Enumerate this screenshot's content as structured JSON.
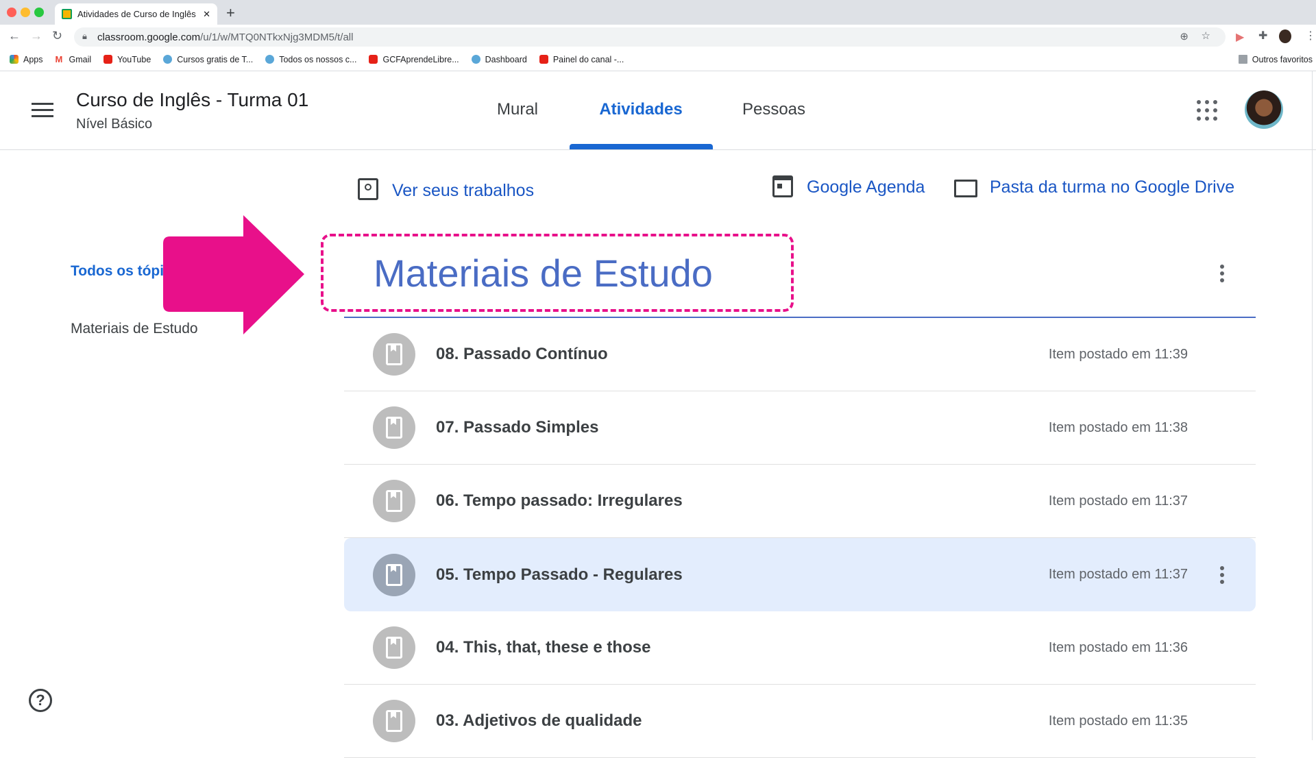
{
  "browser": {
    "tab_title": "Atividades de Curso de Inglês",
    "url_host": "classroom.google.com",
    "url_path": "/u/1/w/MTQ0NTkxNjg3MDM5/t/all",
    "bookmarks": [
      {
        "label": "Apps",
        "icon": "apps-grid-icon"
      },
      {
        "label": "Gmail",
        "icon": "gmail-icon"
      },
      {
        "label": "YouTube",
        "icon": "youtube-icon"
      },
      {
        "label": "Cursos gratis de T...",
        "icon": "globe-icon"
      },
      {
        "label": "Todos os nossos c...",
        "icon": "globe-icon"
      },
      {
        "label": "GCFAprendeLibre...",
        "icon": "youtube-icon"
      },
      {
        "label": "Dashboard",
        "icon": "globe-icon"
      },
      {
        "label": "Painel do canal -...",
        "icon": "youtube-icon"
      }
    ],
    "other_bookmarks": "Outros favoritos"
  },
  "header": {
    "class_title": "Curso de Inglês - Turma 01",
    "class_subtitle": "Nível Básico",
    "tabs": [
      {
        "label": "Mural"
      },
      {
        "label": "Atividades",
        "active": true
      },
      {
        "label": "Pessoas"
      }
    ]
  },
  "actions": {
    "view_work": "Ver seus trabalhos",
    "calendar": "Google Agenda",
    "drive": "Pasta da turma no Google Drive"
  },
  "sidebar": {
    "all_topics": "Todos os tópicos",
    "topics": [
      "Materiais de Estudo"
    ]
  },
  "topic": {
    "title": "Materiais de Estudo",
    "items": [
      {
        "title": "08. Passado Contínuo",
        "time": "Item postado em 11:39"
      },
      {
        "title": "07. Passado Simples",
        "time": "Item postado em 11:38"
      },
      {
        "title": "06. Tempo passado: Irregulares",
        "time": "Item postado em 11:37"
      },
      {
        "title": "05. Tempo Passado - Regulares",
        "time": "Item postado em 11:37",
        "highlighted": true
      },
      {
        "title": "04. This, that, these e those",
        "time": "Item postado em 11:36"
      },
      {
        "title": "03. Adjetivos de qualidade",
        "time": "Item postado em 11:35"
      }
    ]
  },
  "colors": {
    "accent": "#1967d2",
    "annotation": "#e8108a",
    "topic_title": "#4a6cc4",
    "highlight_row": "#e3edfd"
  }
}
